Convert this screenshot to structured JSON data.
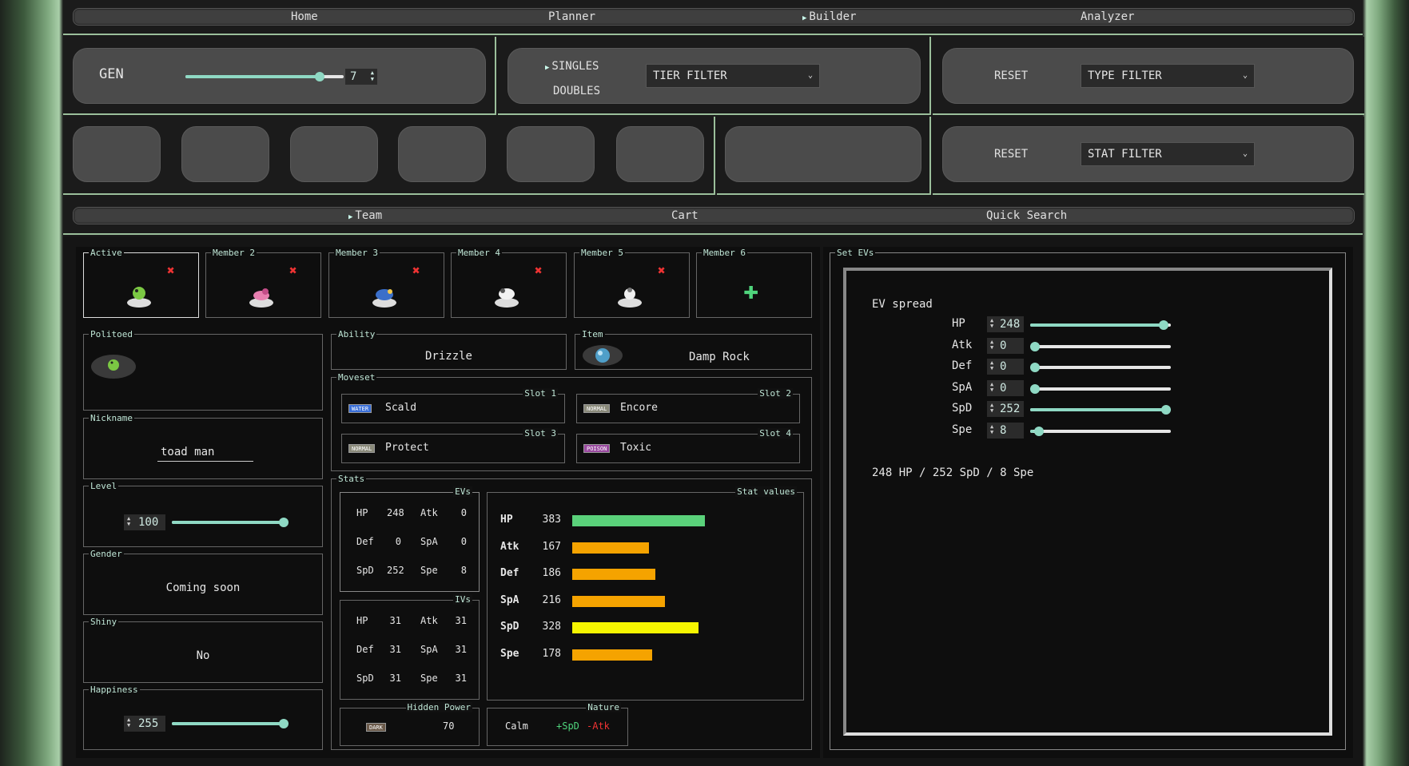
{
  "nav": {
    "home": "Home",
    "planner": "Planner",
    "builder": "Builder",
    "analyzer": "Analyzer"
  },
  "gen": {
    "label": "GEN",
    "value": "7",
    "fraction": 0.85
  },
  "format": {
    "singles": "SINGLES",
    "doubles": "DOUBLES"
  },
  "filters": {
    "tier": "TIER FILTER",
    "type": "TYPE FILTER",
    "stat": "STAT FILTER",
    "reset": "RESET"
  },
  "tabs": {
    "team": "Team",
    "cart": "Cart",
    "quick": "Quick Search"
  },
  "members": [
    {
      "label": "Active",
      "has": true
    },
    {
      "label": "Member 2",
      "has": true
    },
    {
      "label": "Member 3",
      "has": true
    },
    {
      "label": "Member 4",
      "has": true
    },
    {
      "label": "Member 5",
      "has": true
    },
    {
      "label": "Member 6",
      "has": false
    }
  ],
  "pokemon": {
    "name": "Politoed",
    "nickname_label": "Nickname",
    "nickname": "toad man",
    "level_label": "Level",
    "level": "100",
    "gender_label": "Gender",
    "gender": "Coming soon",
    "shiny_label": "Shiny",
    "shiny": "No",
    "happiness_label": "Happiness",
    "happiness": "255"
  },
  "ability": {
    "label": "Ability",
    "value": "Drizzle"
  },
  "item": {
    "label": "Item",
    "value": "Damp Rock"
  },
  "moveset": {
    "label": "Moveset",
    "moves": [
      {
        "slot": "Slot 1",
        "type": "WATER",
        "name": "Scald",
        "color": "#3a6fd8"
      },
      {
        "slot": "Slot 2",
        "type": "NORMAL",
        "name": "Encore",
        "color": "#8a8a7a"
      },
      {
        "slot": "Slot 3",
        "type": "NORMAL",
        "name": "Protect",
        "color": "#8a8a7a"
      },
      {
        "slot": "Slot 4",
        "type": "POISON",
        "name": "Toxic",
        "color": "#9a4aa0"
      }
    ]
  },
  "stats": {
    "label": "Stats",
    "evs_label": "EVs",
    "ivs_label": "IVs",
    "evs": [
      [
        "HP",
        "248",
        "Atk",
        "0"
      ],
      [
        "Def",
        "0",
        "SpA",
        "0"
      ],
      [
        "SpD",
        "252",
        "Spe",
        "8"
      ]
    ],
    "ivs": [
      [
        "HP",
        "31",
        "Atk",
        "31"
      ],
      [
        "Def",
        "31",
        "SpA",
        "31"
      ],
      [
        "SpD",
        "31",
        "Spe",
        "31"
      ]
    ],
    "values_label": "Stat values",
    "values": [
      {
        "name": "HP",
        "value": "383",
        "color": "#5ad17a",
        "frac": 0.43
      },
      {
        "name": "Atk",
        "value": "167",
        "color": "#f5a300",
        "frac": 0.25
      },
      {
        "name": "Def",
        "value": "186",
        "color": "#f5a300",
        "frac": 0.27
      },
      {
        "name": "SpA",
        "value": "216",
        "color": "#f5a300",
        "frac": 0.3
      },
      {
        "name": "SpD",
        "value": "328",
        "color": "#f5f500",
        "frac": 0.41
      },
      {
        "name": "Spe",
        "value": "178",
        "color": "#f5a300",
        "frac": 0.26
      }
    ]
  },
  "hidden_power": {
    "label": "Hidden Power",
    "type": "DARK",
    "value": "70"
  },
  "nature": {
    "label": "Nature",
    "name": "Calm",
    "plus": "+SpD",
    "minus": "-Atk"
  },
  "set_evs": {
    "label": "Set EVs",
    "title": "EV spread",
    "rows": [
      {
        "name": "HP",
        "value": "248",
        "frac": 0.98
      },
      {
        "name": "Atk",
        "value": "0",
        "frac": 0
      },
      {
        "name": "Def",
        "value": "0",
        "frac": 0
      },
      {
        "name": "SpA",
        "value": "0",
        "frac": 0
      },
      {
        "name": "SpD",
        "value": "252",
        "frac": 1
      },
      {
        "name": "Spe",
        "value": "8",
        "frac": 0.03
      }
    ],
    "summary": "248 HP / 252 SpD / 8 Spe"
  }
}
